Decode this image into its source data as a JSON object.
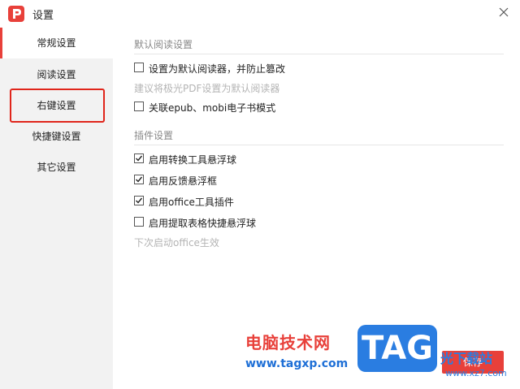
{
  "window": {
    "title": "设置"
  },
  "sidebar": {
    "items": [
      {
        "label": "常规设置",
        "active": true
      },
      {
        "label": "阅读设置",
        "active": false
      },
      {
        "label": "右键设置",
        "active": false,
        "highlighted": true
      },
      {
        "label": "快捷键设置",
        "active": false
      },
      {
        "label": "其它设置",
        "active": false
      }
    ]
  },
  "sections": {
    "reader": {
      "title": "默认阅读设置",
      "options": [
        {
          "label": "设置为默认阅读器，并防止篡改",
          "checked": false
        },
        {
          "label": "关联epub、mobi电子书模式",
          "checked": false
        }
      ],
      "hint": "建议将极光PDF设置为默认阅读器"
    },
    "plugins": {
      "title": "插件设置",
      "options": [
        {
          "label": "启用转换工具悬浮球",
          "checked": true
        },
        {
          "label": "启用反馈悬浮框",
          "checked": true
        },
        {
          "label": "启用office工具插件",
          "checked": true
        },
        {
          "label": "启用提取表格快捷悬浮球",
          "checked": false
        }
      ],
      "hint": "下次启动office生效"
    }
  },
  "footer": {
    "save_label": "保存"
  },
  "watermark": {
    "text": "电脑技术网",
    "url": "www.tagxp.com",
    "tag": "TAG",
    "site_cn": "光下载站",
    "site_en": "www.xz7.com"
  },
  "colors": {
    "accent": "#e8403a",
    "highlight_box": "#e0251b",
    "sidebar_bg": "#f2f2f2"
  },
  "icons": {
    "logo": "app-logo-p-icon",
    "close": "close-icon",
    "check": "checkmark-icon"
  }
}
